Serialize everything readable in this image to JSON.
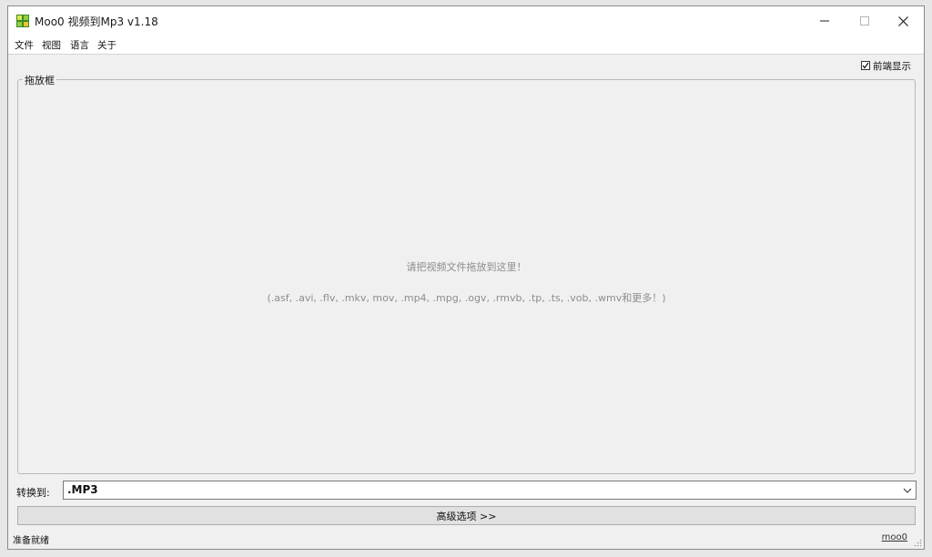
{
  "window": {
    "title": "Moo0 视频到Mp3 v1.18"
  },
  "menu": {
    "items": [
      {
        "label": "文件"
      },
      {
        "label": "视图"
      },
      {
        "label": "语言"
      },
      {
        "label": "关于"
      }
    ]
  },
  "top_most": {
    "label": "前端显示",
    "checked": true
  },
  "drop_area": {
    "legend": "拖放框",
    "instruction": "请把视频文件拖放到这里！",
    "formats": "(.asf, .avi, .flv, .mkv, mov, .mp4, .mpg, .ogv, .rmvb, .tp, .ts, .vob, .wmv和更多！)"
  },
  "convert": {
    "label": "转换到:",
    "selected": ".MP3"
  },
  "advanced": {
    "label": "高级选项 >>"
  },
  "status": {
    "text": "准备就绪",
    "link": "moo0"
  },
  "colors": {
    "window_bg": "#f0f0f0",
    "titlebar_bg": "#ffffff",
    "hint_text": "#8d8d8d",
    "button_bg": "#e1e1e1"
  },
  "icons": {
    "app": "moo0-app-icon",
    "minimize": "minimize-icon",
    "maximize": "maximize-icon",
    "close": "close-icon",
    "checkmark": "checkmark-icon",
    "dropdown": "chevron-down-icon",
    "resize": "resize-grip-icon"
  }
}
